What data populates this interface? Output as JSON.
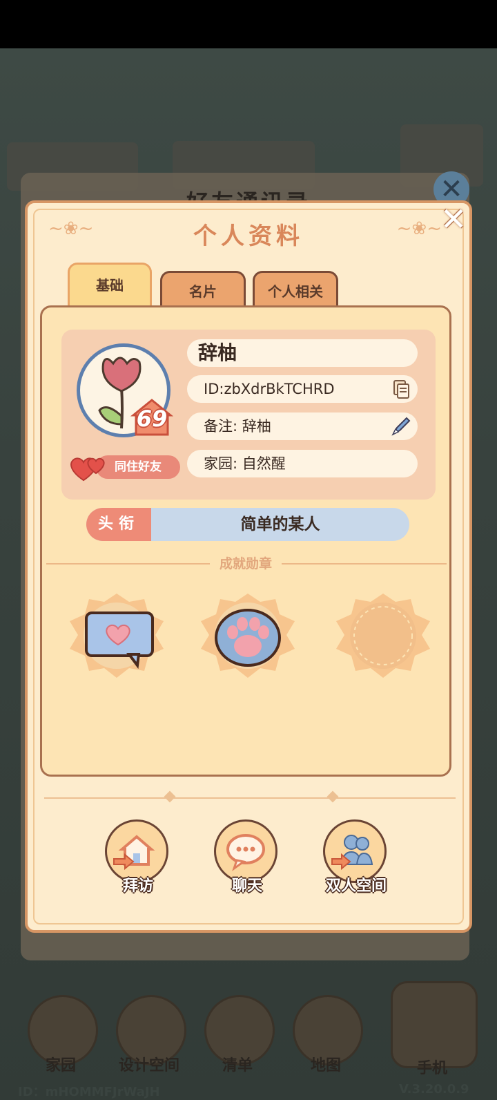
{
  "background": {
    "panel_title": "好友通讯录",
    "nav": [
      {
        "label": "家园",
        "icon": "home-icon"
      },
      {
        "label": "设计空间",
        "icon": "design-icon"
      },
      {
        "label": "清单",
        "icon": "list-icon"
      },
      {
        "label": "地图",
        "icon": "map-pin-icon"
      },
      {
        "label": "手机",
        "icon": "phone-icon"
      }
    ],
    "player_id": "ID：mHOMMFJrWaJH",
    "version": "V.3.20.0.9"
  },
  "dialog": {
    "title": "个人资料",
    "close_label": "✕",
    "tabs": [
      {
        "label": "基础",
        "active": true
      },
      {
        "label": "名片",
        "active": false
      },
      {
        "label": "个人相关",
        "active": false
      }
    ],
    "profile": {
      "name": "辞柚",
      "id": "ID:zbXdrBkTCHRD",
      "remark": "备注: 辞柚",
      "home": "家园: 自然醒",
      "level": "69",
      "relation": "同住好友"
    },
    "title_tag": "头衔",
    "title_value": "简单的某人",
    "achievements_label": "成就勋章",
    "achievements": [
      {
        "icon": "chat-heart-icon",
        "unlocked": true
      },
      {
        "icon": "paw-icon",
        "unlocked": true
      },
      {
        "icon": "empty-medal-icon",
        "unlocked": false
      }
    ],
    "actions": [
      {
        "label": "拜访",
        "icon": "visit-home-icon"
      },
      {
        "label": "聊天",
        "icon": "chat-bubble-icon"
      },
      {
        "label": "双人空间",
        "icon": "two-people-icon"
      }
    ]
  },
  "colors": {
    "accent": "#d9875a",
    "dialog_bg": "#fdeccd",
    "title_tag": "#ee8b77",
    "title_bar": "#c8d8ea"
  }
}
